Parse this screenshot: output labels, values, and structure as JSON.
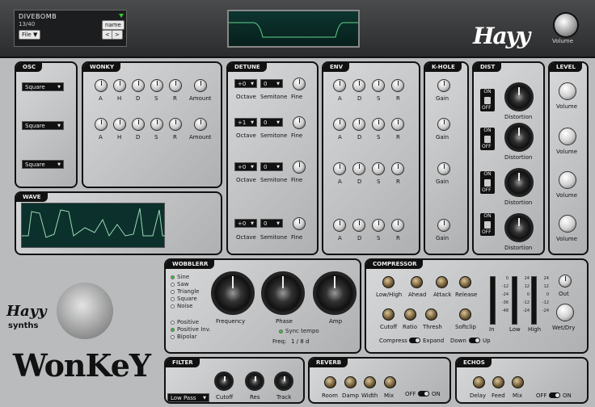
{
  "preset": {
    "name": "DIVEBOMB",
    "number": "13/40",
    "file_label": "File",
    "name_button": "name",
    "prev": "<",
    "next": ">"
  },
  "brand": "Hayy",
  "top_volume_label": "Volume",
  "osc": {
    "title": "OSC",
    "waves": [
      "Square",
      "Square",
      "Square"
    ]
  },
  "wonky": {
    "title": "WONKY",
    "labels": [
      "A",
      "H",
      "D",
      "S",
      "R",
      "Amount"
    ]
  },
  "detune": {
    "title": "DETUNE",
    "octaves": [
      "+0",
      "+1",
      "+0",
      "+0"
    ],
    "semitones": [
      "0",
      "0",
      "0",
      "0"
    ],
    "octave_label": "Octave",
    "semitone_label": "Semitone",
    "fine_label": "Fine"
  },
  "env": {
    "title": "ENV",
    "labels": [
      "A",
      "D",
      "S",
      "R"
    ]
  },
  "khole": {
    "title": "K-HOLE",
    "gain_label": "Gain"
  },
  "dist": {
    "title": "DIST",
    "on": "ON",
    "off": "OFF",
    "label": "Distortion"
  },
  "level": {
    "title": "LEVEL",
    "label": "Volume"
  },
  "wave": {
    "title": "WAVE"
  },
  "wobblerr": {
    "title": "WOBBLERR",
    "shapes": [
      "Sine",
      "Saw",
      "Triangle",
      "Square",
      "Noise"
    ],
    "selected_shape": "Sine",
    "polarity": [
      "Positive",
      "Positive Inv.",
      "Bipolar"
    ],
    "selected_polarity": "Positive Inv.",
    "knobs": [
      "Frequency",
      "Phase",
      "Amp"
    ],
    "sync_label": "Sync tempo",
    "freq_label": "Freq:",
    "freq_value": "1 / 8 d"
  },
  "compressor": {
    "title": "COMPRESSOR",
    "knobs_top": [
      "Low/High",
      "Ahead",
      "Attack",
      "Release"
    ],
    "knobs_bottom": [
      "Cutoff",
      "Ratio",
      "Thresh",
      "Softclip"
    ],
    "meters": [
      "In",
      "Low",
      "High"
    ],
    "scale": [
      "0",
      "-12",
      "-24",
      "-36",
      "-48"
    ],
    "scale2": [
      "24",
      "12",
      "0",
      "-12",
      "-24"
    ],
    "out_label": "Out",
    "wetdry_label": "Wet/Dry",
    "compress": "Compress",
    "expand": "Expand",
    "down": "Down",
    "up": "Up"
  },
  "filter": {
    "title": "FILTER",
    "type": "Low Pass",
    "knobs": [
      "Cutoff",
      "Res",
      "Track"
    ]
  },
  "reverb": {
    "title": "REVERB",
    "knobs": [
      "Room",
      "Damp",
      "Width",
      "Mix"
    ],
    "off": "OFF",
    "on": "ON"
  },
  "echo": {
    "title": "ECHOS",
    "knobs": [
      "Delay",
      "Feed",
      "Mix"
    ],
    "off": "OFF",
    "on": "ON"
  },
  "logo": {
    "brand": "Hayy",
    "synths": "synths",
    "product": "WonKeY"
  }
}
